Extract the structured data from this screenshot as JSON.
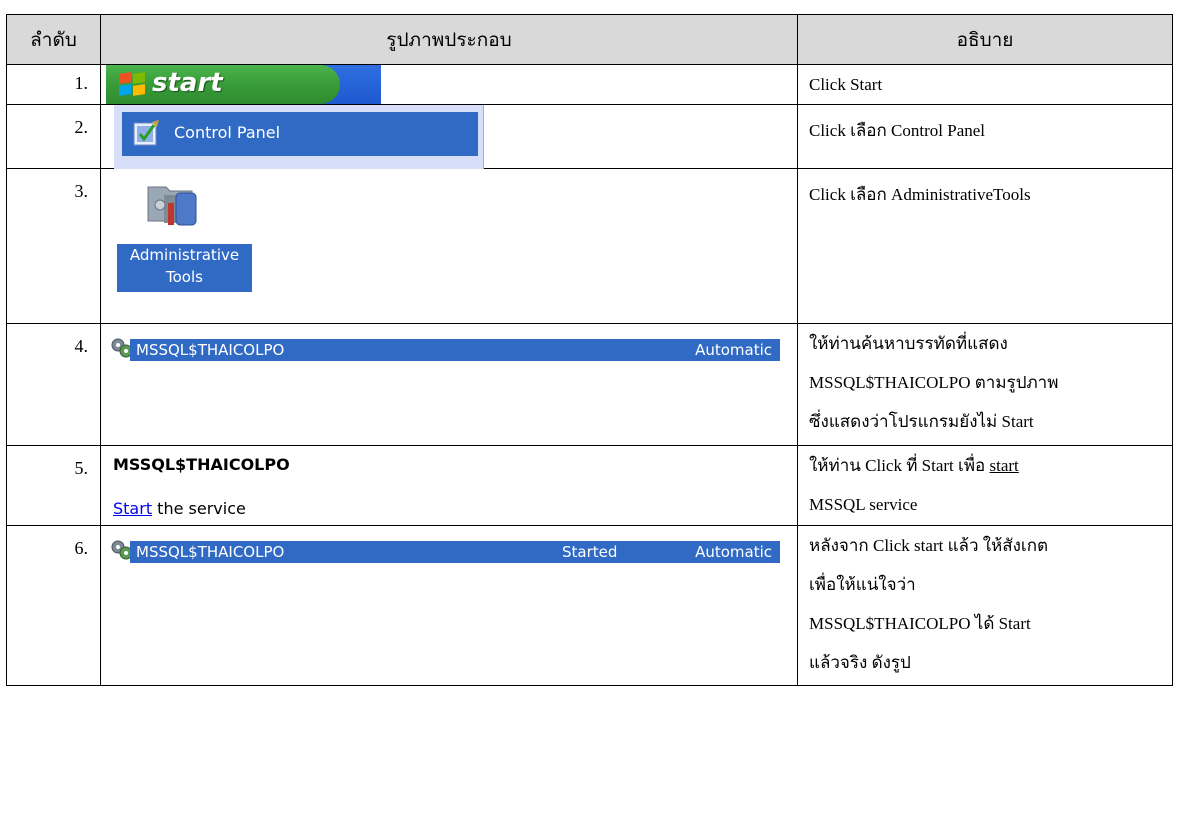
{
  "headers": {
    "order": "ลำดับ",
    "picture": "รูปภาพประกอบ",
    "description": "อธิบาย"
  },
  "rows": [
    {
      "num": "1.",
      "desc": [
        "Click Start"
      ],
      "start_label": "start"
    },
    {
      "num": "2.",
      "desc": [
        "Click เลือก Control Panel"
      ],
      "panel_label": "Control Panel"
    },
    {
      "num": "3.",
      "desc": [
        "Click เลือก AdministrativeTools"
      ],
      "icon_label_1": "Administrative",
      "icon_label_2": "Tools"
    },
    {
      "num": "4.",
      "desc": [
        "ให้ท่านค้นหาบรรทัดที่แสดง",
        "MSSQL$THAICOLPO ตามรูปภาพ",
        "ซึ่งแสดงว่าโปรแกรมยังไม่ Start"
      ],
      "service_name": "MSSQL$THAICOLPO",
      "startup": "Automatic"
    },
    {
      "num": "5.",
      "desc_pre": "ให้ท่าน Click ที่ Start เพื่อ ",
      "desc_link": "start",
      "desc_2": "MSSQL service",
      "service_title": "MSSQL$THAICOLPO",
      "link": "Start",
      "link_rest": " the service"
    },
    {
      "num": "6.",
      "desc": [
        "หลังจาก Click start แล้ว ให้สังเกต",
        "เพื่อให้แน่ใจว่า",
        "MSSQL$THAICOLPO ได้ Start",
        "แล้วจริง ดังรูป"
      ],
      "service_name": "MSSQL$THAICOLPO",
      "status": "Started",
      "startup": "Automatic"
    }
  ],
  "colors": {
    "header_bg": "#d9d9d9",
    "selection": "#316ac5",
    "start_green": "#3a9e3a",
    "taskbar_blue": "#245edb"
  }
}
